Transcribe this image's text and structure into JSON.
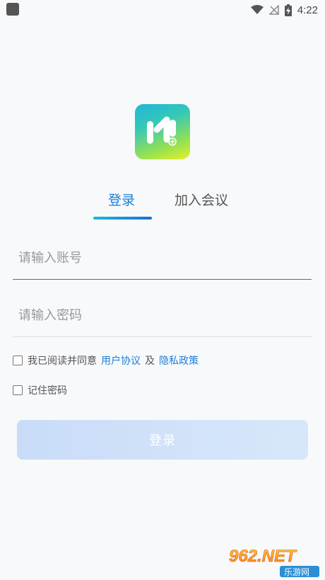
{
  "status_bar": {
    "time": "4:22"
  },
  "tabs": [
    {
      "label": "登录",
      "active": true
    },
    {
      "label": "加入会议",
      "active": false
    }
  ],
  "account_input": {
    "placeholder": "请输入账号",
    "value": ""
  },
  "password_input": {
    "placeholder": "请输入密码",
    "value": ""
  },
  "agreement": {
    "prefix": "我已阅读并同意",
    "user_agreement": "用户协议",
    "conj": "及",
    "privacy_policy": "隐私政策",
    "checked": false
  },
  "remember_password": {
    "label": "记住密码",
    "checked": false
  },
  "login_button": {
    "label": "登录"
  },
  "watermark": {
    "text": "962.NET",
    "sub": "乐游网"
  },
  "colors": {
    "accent": "#1b7fd6",
    "button_disabled": "#cfe1f8"
  }
}
